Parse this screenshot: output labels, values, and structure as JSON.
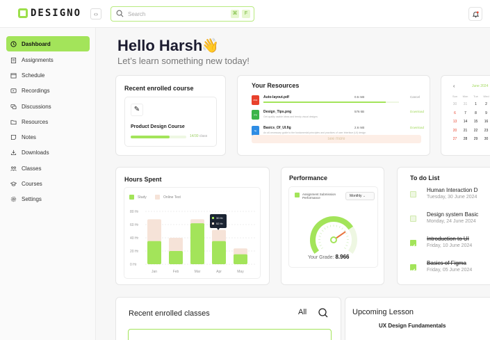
{
  "app": {
    "logo_text": "DESIGNO"
  },
  "search": {
    "placeholder": "Search",
    "shortcut_key1": "⌘",
    "shortcut_key2": "F"
  },
  "sidebar": {
    "items": [
      {
        "label": "Dashboard",
        "icon": "clock-icon",
        "active": true
      },
      {
        "label": "Assignments",
        "icon": "clipboard-icon"
      },
      {
        "label": "Schedule",
        "icon": "calendar-icon"
      },
      {
        "label": "Recordings",
        "icon": "recording-icon"
      },
      {
        "label": "Discussions",
        "icon": "chat-icon"
      },
      {
        "label": "Resources",
        "icon": "folder-icon"
      },
      {
        "label": "Notes",
        "icon": "note-icon"
      },
      {
        "label": "Downloads",
        "icon": "download-icon"
      },
      {
        "label": "Classes",
        "icon": "users-icon"
      },
      {
        "label": "Courses",
        "icon": "graduation-cap-icon"
      },
      {
        "label": "Settings",
        "icon": "gear-icon"
      }
    ]
  },
  "greeting": {
    "title": "Hello Harsh",
    "subtitle": "Let’s learn something new today!"
  },
  "enrolled_course": {
    "title": "Recent enrolled course",
    "course_name": "Product Design Course",
    "progress": 0.7,
    "meta_highlight": "14/30",
    "meta_suffix": "class"
  },
  "resources": {
    "title": "Your Resources",
    "files": [
      {
        "name": "Auto-layout.pdf",
        "type": "PDF",
        "color": "#e8412c",
        "description": "",
        "size": "0.5 mB",
        "status": "Cancel",
        "status_color": "#999",
        "progress": 0.9
      },
      {
        "name": "Design_Tips.png",
        "type": "png",
        "color": "#3bb44a",
        "description": "Get quality usable ideas and trendy visual designs",
        "size": "576 kB",
        "status": "Download",
        "status_color": "#a3d95f"
      },
      {
        "name": "Basics_Of_UI.fig",
        "type": "fig",
        "color": "#2f8de4",
        "description": "An all-necessary guide to the fundamental principles and practices of user Interface (UI) design",
        "size": "2.6 mB",
        "status": "Download",
        "status_color": "#a3d95f"
      }
    ],
    "see_more": "see more"
  },
  "calendar": {
    "prev": "‹",
    "month": "June 2024",
    "weekdays": [
      "Sun",
      "Mon",
      "Tue",
      "Wed",
      "Thu"
    ],
    "weeks": [
      [
        "30",
        "31",
        "1",
        "2",
        "3"
      ],
      [
        "6",
        "7",
        "8",
        "9",
        "10"
      ],
      [
        "13",
        "14",
        "15",
        "16",
        "17"
      ],
      [
        "20",
        "21",
        "22",
        "23",
        "24"
      ],
      [
        "27",
        "28",
        "29",
        "30",
        ""
      ]
    ]
  },
  "hours_spent": {
    "title": "Hours Spent",
    "legend_study": "Study",
    "legend_online": "Online Test",
    "tooltip_study": "30 Hr",
    "tooltip_online": "52 Hr"
  },
  "chart_data": {
    "type": "bar",
    "title": "Hours Spent",
    "categories": [
      "Jan",
      "Feb",
      "Mar",
      "Apr",
      "May"
    ],
    "series": [
      {
        "name": "Study",
        "values": [
          35,
          20,
          62,
          35,
          15
        ],
        "color": "#a3e45a"
      },
      {
        "name": "Online Test",
        "values": [
          68,
          40,
          68,
          52,
          24
        ],
        "color": "#f6e3d8"
      }
    ],
    "yticks": [
      "0 Hr",
      "20 Hr",
      "40 Hr",
      "60 Hr",
      "80 Hr"
    ],
    "ylim": [
      0,
      80
    ],
    "grid": true
  },
  "performance": {
    "title": "Performance",
    "legend": "Assignment Submission Performance",
    "period": "Monthly",
    "grade_label": "Your Grade:",
    "grade_value": "8.966",
    "gauge_fraction": 0.72
  },
  "todo": {
    "title": "To do List",
    "items": [
      {
        "title": "Human Interaction D",
        "date": "Tuesday, 30 June 2024",
        "done": false
      },
      {
        "title": "Design system Basic",
        "date": "Monday, 24 June 2024",
        "done": false
      },
      {
        "title": "Introduction to UI",
        "date": "Friday, 10 June 2024",
        "done": true
      },
      {
        "title": "Basics of Figma",
        "date": "Friday, 05 June 2024",
        "done": true
      }
    ]
  },
  "recent_classes": {
    "title": "Recent enrolled classes",
    "filter": "All"
  },
  "upcoming": {
    "title": "Upcoming Lesson",
    "first_item": "UX Design Fundamentals"
  },
  "colors": {
    "accent": "#a3e45a",
    "accent_light": "#eef7e2",
    "peach": "#f6e3d8"
  }
}
